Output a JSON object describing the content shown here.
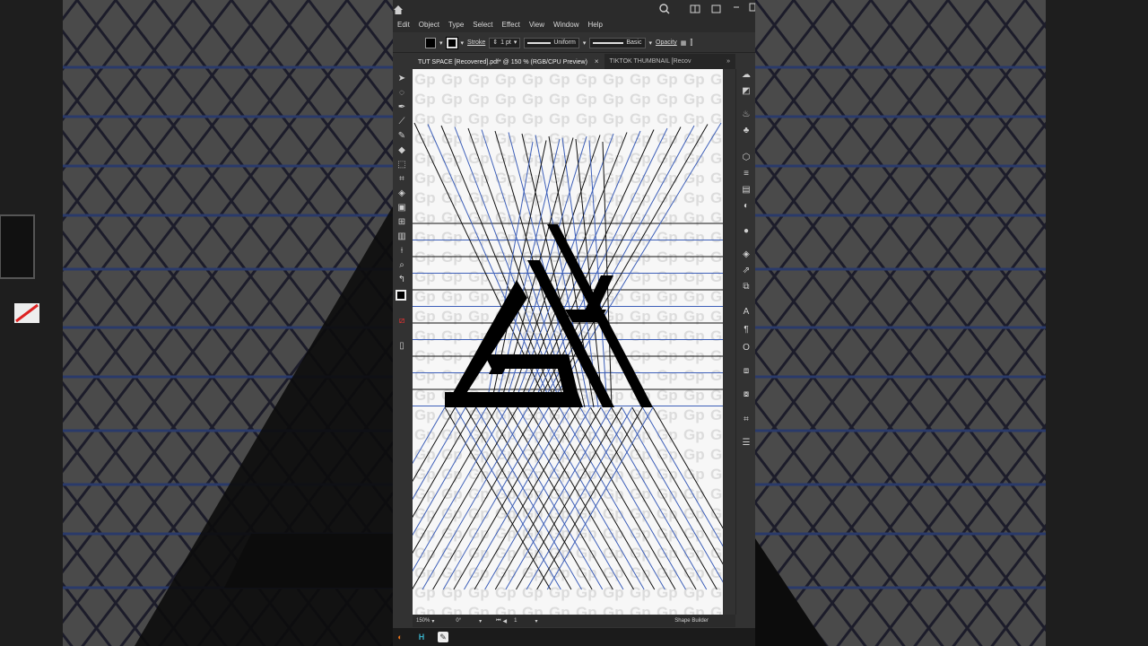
{
  "menu": [
    "Edit",
    "Object",
    "Type",
    "Select",
    "Effect",
    "View",
    "Window",
    "Help"
  ],
  "titlebar": {
    "icons": [
      "home-icon",
      "search-icon",
      "arrange-documents-icon",
      "restore-icon",
      "minimize-icon"
    ]
  },
  "control": {
    "stroke_label": "Stroke",
    "stroke_weight": "1 pt",
    "profile_uniform": "Uniform",
    "brush_basic": "Basic",
    "opacity_label": "Opacity"
  },
  "tabs": [
    {
      "label": "TUT SPACE [Recovered].pdf* @ 150 % (RGB/CPU Preview)",
      "active": true
    },
    {
      "label": "TIKTOK THUMBNAIL [Recov",
      "active": false
    }
  ],
  "tab_close": "×",
  "tab_overflow": "»",
  "status": {
    "zoom": "150%",
    "rotation": "0°",
    "artboard": "1",
    "tool": "Shape Builder"
  },
  "watermark_text": "Gp",
  "colors": {
    "grid_blue": "#3d5fb8",
    "grid_black": "#111111",
    "logo": "#000000",
    "app_bg": "#323232"
  }
}
